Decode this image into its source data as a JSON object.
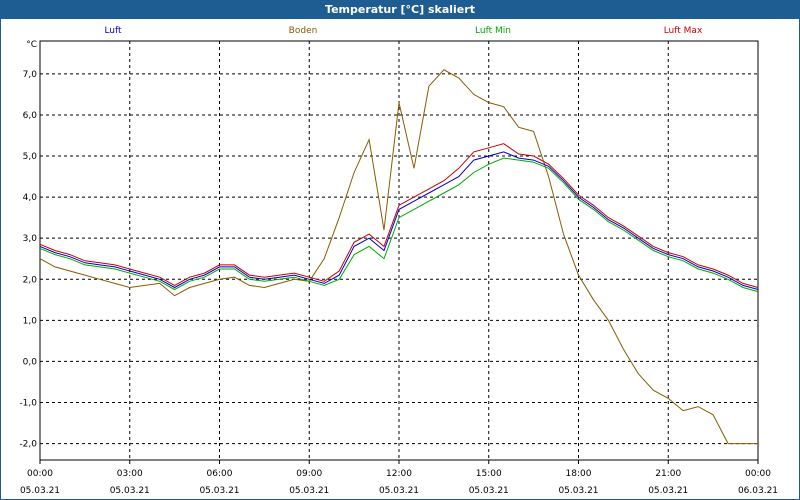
{
  "window": {
    "title": "Temperatur [°C] skaliert"
  },
  "chart_data": {
    "type": "line",
    "title": "Temperatur [°C] skaliert",
    "ylabel": "°C",
    "xlabel": "",
    "x_ticks": [
      {
        "time": "00:00",
        "date": "05.03.21"
      },
      {
        "time": "03:00",
        "date": "05.03.21"
      },
      {
        "time": "06:00",
        "date": "05.03.21"
      },
      {
        "time": "09:00",
        "date": "05.03.21"
      },
      {
        "time": "12:00",
        "date": "05.03.21"
      },
      {
        "time": "15:00",
        "date": "05.03.21"
      },
      {
        "time": "18:00",
        "date": "05.03.21"
      },
      {
        "time": "21:00",
        "date": "05.03.21"
      },
      {
        "time": "00:00",
        "date": "06.03.21"
      }
    ],
    "y_ticks": [
      "7,0",
      "6,0",
      "5,0",
      "4,0",
      "3,0",
      "2,0",
      "1,0",
      "0,0",
      "-1,0",
      "-2,0"
    ],
    "x_range": [
      "05.03.21 00:00",
      "06.03.21 00:00"
    ],
    "ylim": [
      -2.4,
      7.8
    ],
    "grid": true,
    "legend_position": "top",
    "x_hours": [
      0,
      0.5,
      1,
      1.5,
      2,
      2.5,
      3,
      3.5,
      4,
      4.5,
      5,
      5.5,
      6,
      6.5,
      7,
      7.5,
      8,
      8.5,
      9,
      9.5,
      10,
      10.5,
      11,
      11.5,
      12,
      12.5,
      13,
      13.5,
      14,
      14.5,
      15,
      15.5,
      16,
      16.5,
      17,
      17.5,
      18,
      18.5,
      19,
      19.5,
      20,
      20.5,
      21,
      21.5,
      22,
      22.5,
      23,
      23.5,
      24
    ],
    "series": [
      {
        "name": "Luft",
        "color": "#0000cc",
        "values": [
          2.8,
          2.65,
          2.55,
          2.4,
          2.35,
          2.3,
          2.2,
          2.1,
          2.0,
          1.8,
          2.0,
          2.1,
          2.3,
          2.3,
          2.05,
          2.0,
          2.05,
          2.1,
          2.0,
          1.9,
          2.1,
          2.8,
          3.0,
          2.7,
          3.7,
          3.9,
          4.1,
          4.3,
          4.5,
          4.9,
          5.0,
          5.1,
          4.95,
          4.9,
          4.75,
          4.4,
          4.0,
          3.75,
          3.45,
          3.25,
          3.0,
          2.75,
          2.6,
          2.5,
          2.3,
          2.2,
          2.05,
          1.85,
          1.75
        ]
      },
      {
        "name": "Boden",
        "color": "#8b5a00",
        "values": [
          2.5,
          2.3,
          2.2,
          2.1,
          2.0,
          1.9,
          1.8,
          1.85,
          1.9,
          1.6,
          1.8,
          1.9,
          2.0,
          2.05,
          1.85,
          1.8,
          1.9,
          2.0,
          1.95,
          2.5,
          3.5,
          4.6,
          5.4,
          3.2,
          6.3,
          4.7,
          6.7,
          7.1,
          6.9,
          6.5,
          6.3,
          6.2,
          5.7,
          5.6,
          4.5,
          3.1,
          2.1,
          1.5,
          1.0,
          0.3,
          -0.3,
          -0.7,
          -0.9,
          -1.2,
          -1.1,
          -1.3,
          -2.0,
          -2.0,
          -2.0
        ]
      },
      {
        "name": "Luft Min",
        "color": "#00aa00",
        "values": [
          2.75,
          2.6,
          2.5,
          2.35,
          2.3,
          2.25,
          2.15,
          2.05,
          1.95,
          1.75,
          1.95,
          2.05,
          2.25,
          2.25,
          2.0,
          1.95,
          2.0,
          2.05,
          1.95,
          1.85,
          2.0,
          2.6,
          2.8,
          2.5,
          3.5,
          3.7,
          3.9,
          4.1,
          4.3,
          4.6,
          4.8,
          4.95,
          4.9,
          4.85,
          4.7,
          4.35,
          3.95,
          3.7,
          3.4,
          3.2,
          2.95,
          2.7,
          2.55,
          2.45,
          2.25,
          2.15,
          2.0,
          1.8,
          1.7
        ]
      },
      {
        "name": "Luft Max",
        "color": "#cc0000",
        "values": [
          2.85,
          2.7,
          2.6,
          2.45,
          2.4,
          2.35,
          2.25,
          2.15,
          2.05,
          1.85,
          2.05,
          2.15,
          2.35,
          2.35,
          2.1,
          2.05,
          2.1,
          2.15,
          2.05,
          1.95,
          2.2,
          2.9,
          3.1,
          2.8,
          3.8,
          4.0,
          4.2,
          4.4,
          4.7,
          5.1,
          5.2,
          5.3,
          5.05,
          5.0,
          4.8,
          4.45,
          4.05,
          3.8,
          3.5,
          3.3,
          3.05,
          2.8,
          2.65,
          2.55,
          2.35,
          2.25,
          2.1,
          1.9,
          1.8
        ]
      }
    ]
  }
}
